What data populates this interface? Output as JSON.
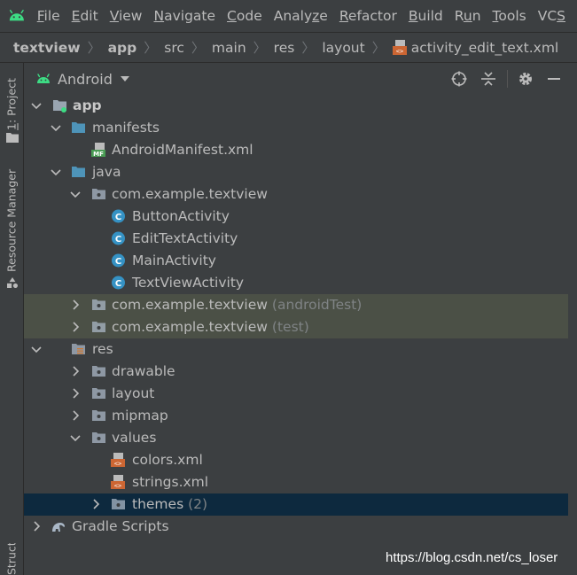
{
  "menubar": {
    "items": [
      {
        "pre": "",
        "mn": "F",
        "post": "ile"
      },
      {
        "pre": "",
        "mn": "E",
        "post": "dit"
      },
      {
        "pre": "",
        "mn": "V",
        "post": "iew"
      },
      {
        "pre": "",
        "mn": "N",
        "post": "avigate"
      },
      {
        "pre": "",
        "mn": "C",
        "post": "ode"
      },
      {
        "pre": "Analy",
        "mn": "z",
        "post": "e"
      },
      {
        "pre": "",
        "mn": "R",
        "post": "efactor"
      },
      {
        "pre": "",
        "mn": "B",
        "post": "uild"
      },
      {
        "pre": "R",
        "mn": "u",
        "post": "n"
      },
      {
        "pre": "",
        "mn": "T",
        "post": "ools"
      },
      {
        "pre": "VC",
        "mn": "S",
        "post": ""
      }
    ]
  },
  "breadcrumb": {
    "items": [
      "textview",
      "app",
      "src",
      "main",
      "res",
      "layout",
      "activity_edit_text.xml"
    ]
  },
  "left_stripe": {
    "project_tab_num": "1",
    "project_tab_label": ": Project",
    "resource_manager_label": "Resource Manager",
    "structure_label": "Structure"
  },
  "panel": {
    "view_title": "Android"
  },
  "tree": {
    "rows": [
      {
        "label": "app",
        "suffix": "",
        "chevron": "down",
        "icon": "module-folder-icon",
        "bold": true
      },
      {
        "label": "manifests",
        "suffix": "",
        "chevron": "down",
        "icon": "folder-icon"
      },
      {
        "label": "AndroidManifest.xml",
        "suffix": "",
        "chevron": "none",
        "icon": "manifest-file-icon"
      },
      {
        "label": "java",
        "suffix": "",
        "chevron": "down",
        "icon": "folder-icon"
      },
      {
        "label": "com.example.textview",
        "suffix": "",
        "chevron": "down",
        "icon": "package-icon"
      },
      {
        "label": "ButtonActivity",
        "suffix": "",
        "chevron": "none",
        "icon": "class-icon"
      },
      {
        "label": "EditTextActivity",
        "suffix": "",
        "chevron": "none",
        "icon": "class-icon"
      },
      {
        "label": "MainActivity",
        "suffix": "",
        "chevron": "none",
        "icon": "class-icon"
      },
      {
        "label": "TextViewActivity",
        "suffix": "",
        "chevron": "none",
        "icon": "class-icon"
      },
      {
        "label": "com.example.textview",
        "suffix": "(androidTest)",
        "chevron": "right",
        "icon": "package-icon",
        "state": "highlighted"
      },
      {
        "label": "com.example.textview",
        "suffix": "(test)",
        "chevron": "right",
        "icon": "package-icon",
        "state": "highlighted"
      },
      {
        "label": "res",
        "suffix": "",
        "chevron": "down",
        "icon": "res-folder-icon"
      },
      {
        "label": "drawable",
        "suffix": "",
        "chevron": "right",
        "icon": "package-icon"
      },
      {
        "label": "layout",
        "suffix": "",
        "chevron": "right",
        "icon": "package-icon"
      },
      {
        "label": "mipmap",
        "suffix": "",
        "chevron": "right",
        "icon": "package-icon"
      },
      {
        "label": "values",
        "suffix": "",
        "chevron": "down",
        "icon": "package-icon"
      },
      {
        "label": "colors.xml",
        "suffix": "",
        "chevron": "none",
        "icon": "xml-file-icon"
      },
      {
        "label": "strings.xml",
        "suffix": "",
        "chevron": "none",
        "icon": "xml-file-icon"
      },
      {
        "label": "themes",
        "suffix": "(2)",
        "chevron": "right",
        "icon": "package-icon",
        "state": "selected"
      },
      {
        "label": "Gradle Scripts",
        "suffix": "",
        "chevron": "right",
        "icon": "gradle-icon"
      }
    ]
  },
  "watermark": "https://blog.csdn.net/cs_loser",
  "colors": {
    "background": "#3c3f41",
    "text": "#bbbbbb",
    "highlight_row": "#4b5046",
    "selected_row": "#0d293e",
    "android_green": "#3ddc84",
    "folder_blue": "#4e94b9",
    "class_icon": "#3592c4",
    "xml_orange": "#cc6633"
  }
}
